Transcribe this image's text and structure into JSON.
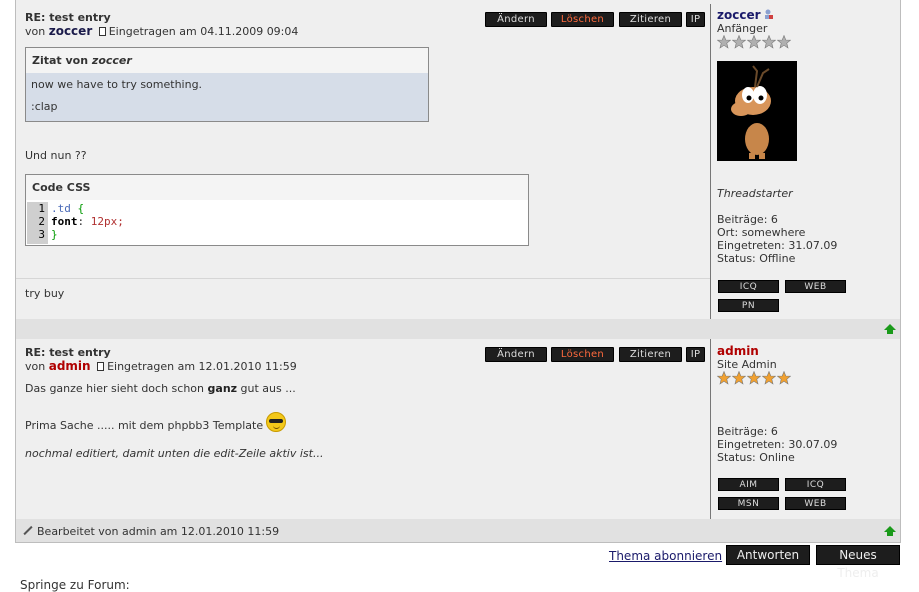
{
  "actions": {
    "edit": "Ändern",
    "delete": "Löschen",
    "quote": "Zitieren",
    "ip": "IP"
  },
  "post1": {
    "title": "RE: test entry",
    "by": "von",
    "author": "zoccer",
    "date": "Eingetragen am 04.11.2009 09:04",
    "quote": {
      "head": "Zitat von",
      "author": "zoccer",
      "line1": "now we have to try something.",
      "line2": ":clap"
    },
    "text1": "Und nun ??",
    "code": {
      "head": "Code CSS",
      "line_numbers": [
        "1",
        "2",
        "3"
      ],
      "selector": ".td",
      "open_brace": "{",
      "property": "font",
      "colon": ":",
      "value": "12px;",
      "close_brace": "}"
    },
    "signature": "try buy",
    "sidebar": {
      "name": "zoccer",
      "rank": "Anfänger",
      "stars_filled": 0,
      "stars_total": 5,
      "role": "Threadstarter",
      "posts": "Beiträge: 6",
      "location": "Ort: somewhere",
      "joined": "Eingetreten: 31.07.09",
      "status": "Status: Offline",
      "buttons": [
        "ICQ",
        "WEB",
        "PN"
      ]
    }
  },
  "post2": {
    "title": "RE: test entry",
    "by": "von",
    "author": "admin",
    "date": "Eingetragen am 12.01.2010 11:59",
    "text1_a": "Das ganze hier sieht doch schon",
    "text1_b": "ganz",
    "text1_c": "gut aus ...",
    "text2": "Prima Sache ..... mit dem phpbb3 Template",
    "text3": "nochmal editiert, damit unten die edit-Zeile aktiv ist...",
    "edited": "Bearbeitet von admin am 12.01.2010 11:59",
    "sidebar": {
      "name": "admin",
      "rank": "Site Admin",
      "stars_filled": 5,
      "stars_total": 5,
      "posts": "Beiträge: 6",
      "joined": "Eingetreten: 30.07.09",
      "status": "Status: Online",
      "buttons": [
        "AIM",
        "ICQ",
        "MSN",
        "WEB"
      ]
    }
  },
  "footer": {
    "subscribe": "Thema abonnieren",
    "reply": "Antworten",
    "new_topic": "Neues Thema",
    "jump": "Springe zu Forum:"
  },
  "colors": {
    "star_gray": "#b0b0b0",
    "star_gold": "#f0a030",
    "up_arrow": "#1a9a1a"
  },
  "icons": [
    "doc-icon",
    "online-user-icon",
    "up-arrow-icon",
    "pencil-icon",
    "cool-smiley-icon",
    "avatar-image"
  ]
}
